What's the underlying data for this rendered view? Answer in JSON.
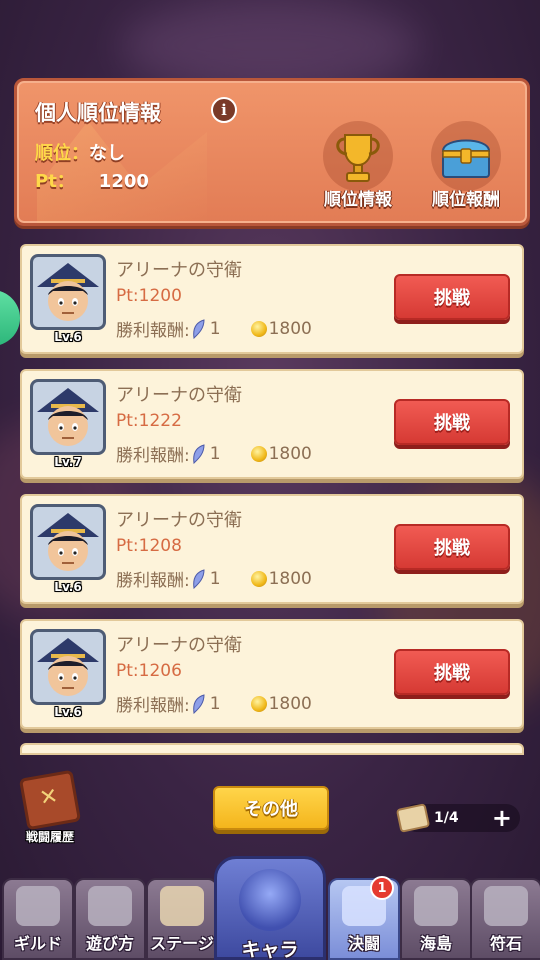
{
  "ranking": {
    "title": "個人順位情報",
    "info_icon": "i",
    "rank_label": "順位：",
    "rank_value": "なし",
    "pt_label": "Pt：",
    "pt_value": "1200",
    "buttons": [
      {
        "label": "順位情報",
        "icon": "trophy-icon"
      },
      {
        "label": "順位報酬",
        "icon": "treasure-chest-icon"
      }
    ]
  },
  "opponents": [
    {
      "name": "アリーナの守衛",
      "pt": "Pt:1200",
      "reward_label": "勝利報酬:",
      "feather": "1",
      "coins": "1800",
      "level": "Lv.6",
      "button": "挑戦"
    },
    {
      "name": "アリーナの守衛",
      "pt": "Pt:1222",
      "reward_label": "勝利報酬:",
      "feather": "1",
      "coins": "1800",
      "level": "Lv.7",
      "button": "挑戦"
    },
    {
      "name": "アリーナの守衛",
      "pt": "Pt:1208",
      "reward_label": "勝利報酬:",
      "feather": "1",
      "coins": "1800",
      "level": "Lv.6",
      "button": "挑戦"
    },
    {
      "name": "アリーナの守衛",
      "pt": "Pt:1206",
      "reward_label": "勝利報酬:",
      "feather": "1",
      "coins": "1800",
      "level": "Lv.6",
      "button": "挑戦"
    }
  ],
  "history_label": "戦闘履歴",
  "other_button": "その他",
  "tickets": "1/4",
  "tickets_plus": "+",
  "tabs": [
    {
      "label": "ギルド",
      "icon": "guild-icon"
    },
    {
      "label": "遊び方",
      "icon": "how-to-play-icon"
    },
    {
      "label": "ステージ",
      "icon": "stage-map-icon"
    },
    {
      "label": "キャラ",
      "icon": "character-icon"
    },
    {
      "label": "決闘",
      "icon": "duel-swords-icon",
      "badge": "1"
    },
    {
      "label": "海島",
      "icon": "island-icon"
    },
    {
      "label": "符石",
      "icon": "rune-stone-icon"
    }
  ],
  "colors": {
    "panel": "#e27c55",
    "card_bg": "#fdf3da",
    "challenge": "#d63a34",
    "other_button": "#f4b51c",
    "pt_text": "#d66b43",
    "active_tab": "#7b8ed8"
  }
}
